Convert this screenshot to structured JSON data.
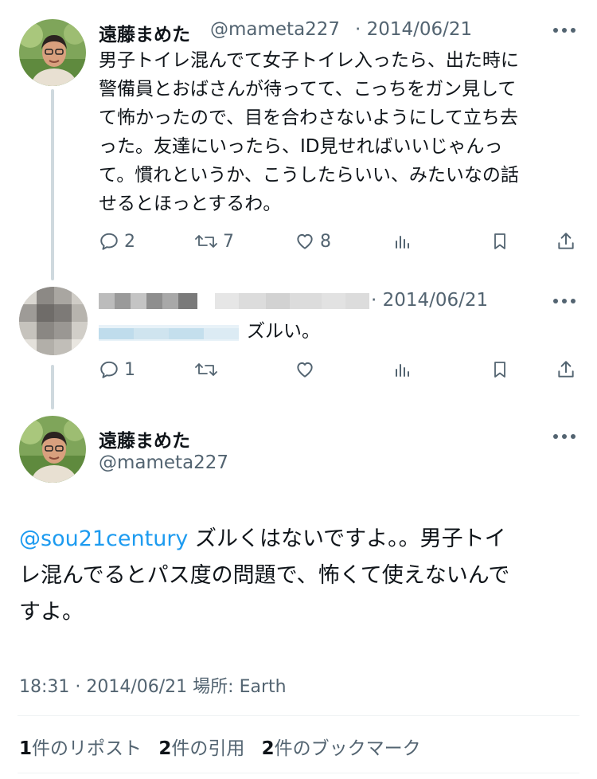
{
  "tweet1": {
    "name": "遠藤まめた",
    "handle": "@mameta227",
    "date": "· 2014/06/21",
    "lines": [
      "男子トイレ混んでて女子トイレ入ったら、出た時に",
      "警備員とおばさんが待ってて、こっちをガン見して",
      "て怖かったので、目を合わさないようにして立ち去",
      "った。友達にいったら、ID見せればいいじゃんっ",
      "て。慣れというか、こうしたらいい、みたいなの話",
      "せるとほっとするわ。"
    ],
    "actions": {
      "reply": "2",
      "retweet": "7",
      "like": "8"
    }
  },
  "tweet2": {
    "date": "· 2014/06/21",
    "text": "ズルい。",
    "actions": {
      "reply": "1"
    }
  },
  "main_tweet": {
    "name": "遠藤まめた",
    "handle": "@mameta227",
    "mention": "@sou21century",
    "line1": " ズルくはないですよ。。男子トイ",
    "line2": "レ混んでるとパス度の問題で、怖くて使えないんで",
    "line3": "すよ。",
    "meta": "18:31 · 2014/06/21 場所: Earth"
  },
  "stats": {
    "reposts_count": "1",
    "reposts_label": "件のリポスト",
    "quotes_count": "2",
    "quotes_label": "件の引用",
    "bookmarks_count": "2",
    "bookmarks_label": "件のブックマーク"
  },
  "colors": {
    "text": "#0f1419",
    "muted": "#536471",
    "link": "#1d9bf0",
    "thread_line": "#cfd9de"
  }
}
